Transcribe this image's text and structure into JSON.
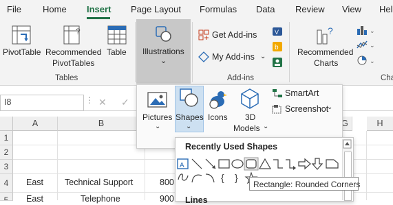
{
  "menu": {
    "tabs": [
      {
        "label": "File"
      },
      {
        "label": "Home"
      },
      {
        "label": "Insert",
        "active": true
      },
      {
        "label": "Page Layout"
      },
      {
        "label": "Formulas"
      },
      {
        "label": "Data"
      },
      {
        "label": "Review"
      },
      {
        "label": "View"
      },
      {
        "label": "Help"
      }
    ]
  },
  "ribbon": {
    "tables": {
      "group_label": "Tables",
      "pivottable": "PivotTable",
      "recommended_pivot_line1": "Recommended",
      "recommended_pivot_line2": "PivotTables",
      "table": "Table"
    },
    "illustrations": {
      "label": "Illustrations",
      "chevron": "⌄"
    },
    "addins": {
      "group_label": "Add-ins",
      "get_addins": "Get Add-ins",
      "my_addins": "My Add-ins"
    },
    "charts": {
      "recommended_line1": "Recommended",
      "recommended_line2": "Charts",
      "group_label_partial": "Cha"
    }
  },
  "formula_bar": {
    "name_box": "I8",
    "cancel": "✕",
    "enter": "✓"
  },
  "grid": {
    "columns": [
      "A",
      "B",
      "",
      "G",
      "H"
    ],
    "rows": [
      "1",
      "2",
      "3",
      "4",
      "5"
    ],
    "cells": {
      "a4": "East",
      "b4": "Technical Support",
      "c4": "800",
      "a5": "East",
      "b5": "Telephone",
      "c5": "900"
    }
  },
  "illustrations_dropdown": {
    "pictures": "Pictures",
    "shapes": "Shapes",
    "icons": "Icons",
    "models_line1": "3D",
    "models_line2": "Models",
    "smartart": "SmartArt",
    "screenshot": "Screenshot"
  },
  "shapes_panel": {
    "heading": "Recently Used Shapes",
    "next_heading_partial": "Lines",
    "shapes_row1": [
      "text-box",
      "line",
      "line-diagonal",
      "rectangle",
      "oval",
      "rounded-rectangle",
      "triangle",
      "elbow-connector",
      "elbow-arrow-connector",
      "right-arrow",
      "down-arrow",
      "snip-rectangle"
    ],
    "shapes_row2": [
      "freeform",
      "arc",
      "curve",
      "left-brace",
      "right-brace",
      "star"
    ]
  },
  "tooltip": {
    "text": "Rectangle: Rounded Corners"
  },
  "colors": {
    "accent_green": "#1f7145",
    "selected_blue": "#cde0f1",
    "pressed_gray": "#c8c8c8",
    "icon_blue": "#2b6cb5"
  }
}
